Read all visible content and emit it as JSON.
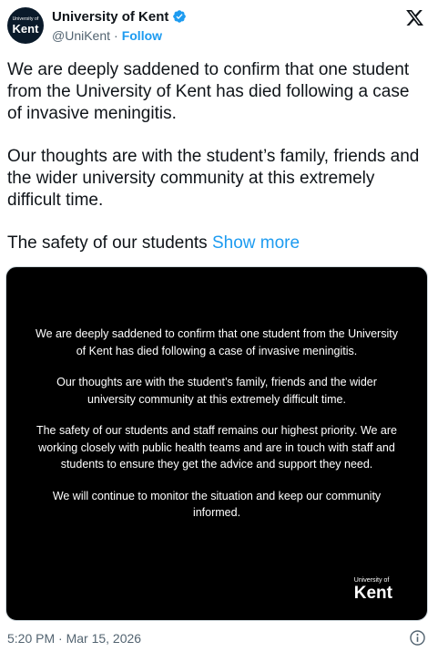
{
  "author": {
    "avatar_line1": "University of",
    "avatar_line2": "Kent",
    "display_name": "University of Kent",
    "handle": "@UniKent",
    "separator": "·",
    "follow_label": "Follow"
  },
  "tweet": {
    "paragraphs": [
      "We are deeply saddened to confirm that one student from the University of Kent has died following a case of invasive meningitis.",
      "Our thoughts are with the student’s family, friends and the wider university community at this extremely difficult time."
    ],
    "truncated_text": "The safety of our students",
    "show_more_label": "Show more"
  },
  "media": {
    "paragraphs": [
      "We are deeply saddened to confirm that one student from the University of Kent has died following a case of invasive meningitis.",
      "Our thoughts are with the student’s family, friends and the wider university community at this extremely difficult time.",
      "The safety of our students and staff remains our highest priority. We are working closely with public health teams and are in touch with staff and students to ensure they get the advice and support they need.",
      "We will continue to monitor the situation and keep our community informed."
    ],
    "logo_line1": "University of",
    "logo_line2": "Kent"
  },
  "footer": {
    "timestamp": "5:20 PM · Mar 15, 2026"
  },
  "icons": {
    "verified": "verified-badge-icon",
    "x_logo": "x-logo-icon",
    "info": "info-icon"
  },
  "colors": {
    "accent": "#1d9bf0",
    "secondary_text": "#536471",
    "media_background": "#000000"
  }
}
